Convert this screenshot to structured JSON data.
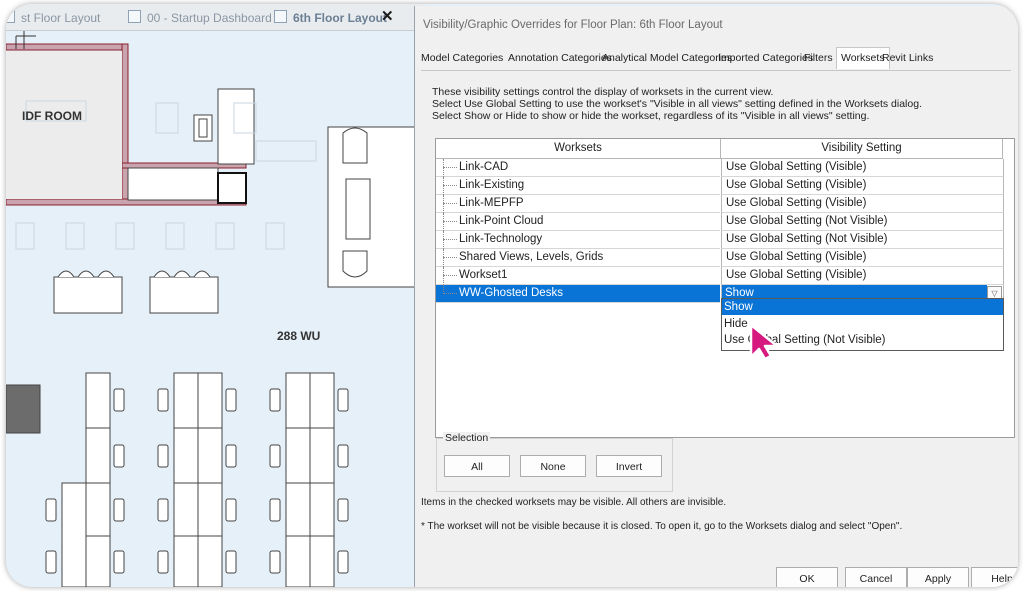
{
  "revit": {
    "tabs": [
      {
        "label": "st Floor Layout"
      },
      {
        "label": "00 - Startup Dashboard"
      },
      {
        "label": "6th Floor Layout"
      }
    ],
    "room_labels": [
      "IDF ROOM",
      "288 WU"
    ]
  },
  "dialog": {
    "title": "Visibility/Graphic Overrides for Floor Plan: 6th Floor Layout",
    "tabs": [
      {
        "label": "Model Categories",
        "active": false
      },
      {
        "label": "Annotation Categories",
        "active": false
      },
      {
        "label": "Analytical Model Categories",
        "active": false
      },
      {
        "label": "Imported Categories",
        "active": false
      },
      {
        "label": "Filters",
        "active": false
      },
      {
        "label": "Worksets",
        "active": true
      },
      {
        "label": "Revit Links",
        "active": false
      }
    ],
    "info_lines": [
      "These visibility settings control the display of worksets in the current view.",
      "Select Use Global Setting to use the workset's \"Visible in all views\" setting defined in the Worksets dialog.",
      "Select Show or Hide to show or hide the workset, regardless of its \"Visible in all views\" setting."
    ],
    "grid": {
      "headers": [
        "Worksets",
        "Visibility Setting"
      ],
      "rows": [
        {
          "workset": "Link-CAD",
          "setting": "Use Global Setting (Visible)"
        },
        {
          "workset": "Link-Existing",
          "setting": "Use Global Setting (Visible)"
        },
        {
          "workset": "Link-MEPFP",
          "setting": "Use Global Setting (Visible)"
        },
        {
          "workset": "Link-Point Cloud",
          "setting": "Use Global Setting (Not Visible)"
        },
        {
          "workset": "Link-Technology",
          "setting": "Use Global Setting (Not Visible)"
        },
        {
          "workset": "Shared Views, Levels, Grids",
          "setting": "Use Global Setting (Visible)"
        },
        {
          "workset": "Workset1",
          "setting": "Use Global Setting (Visible)"
        },
        {
          "workset": "WW-Ghosted Desks",
          "setting": "Show"
        }
      ],
      "dropdown_options": [
        "Show",
        "Hide",
        "Use Global Setting (Not Visible)"
      ],
      "highlighted_option": "Show"
    },
    "selection": {
      "legend": "Selection",
      "buttons": [
        "All",
        "None",
        "Invert"
      ]
    },
    "notes": [
      "Items in the checked worksets may be visible.  All others are invisible.",
      "* The workset will not be visible because it is closed. To open it, go to the Worksets dialog and select \"Open\"."
    ],
    "footer_buttons": [
      "OK",
      "Cancel",
      "Apply",
      "Help"
    ]
  },
  "colors": {
    "selection_blue": "#0a74d6",
    "cursor_magenta": "#d6197e",
    "plan_background": "#e6f0f8"
  }
}
